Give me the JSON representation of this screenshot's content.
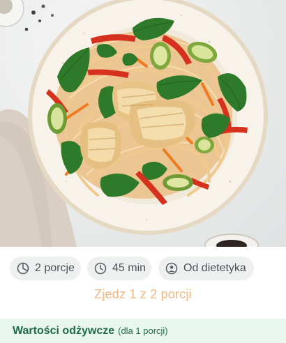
{
  "hero": {
    "image_alt": "Makaron z rybą, szpinakiem, cukinią i papryką"
  },
  "chips": {
    "portions": "2 porcje",
    "time": "45 min",
    "author": "Od dietetyka"
  },
  "portion_prompt": "Zjedz 1 z 2 porcji",
  "nutrition": {
    "title": "Wartości odżywcze",
    "subtitle": "(dla 1 porcji)"
  },
  "colors": {
    "accent_orange": "#f2b784",
    "nutrition_bg": "#e9f6ee",
    "nutrition_text": "#1f6b45",
    "chip_bg": "#eef0f0"
  },
  "icons": [
    "pie-chart-icon",
    "clock-icon",
    "user-icon"
  ]
}
